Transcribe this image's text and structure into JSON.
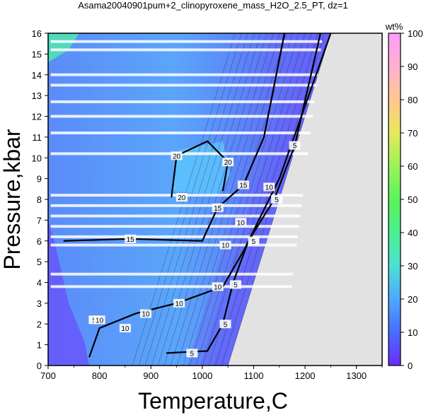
{
  "chart_data": {
    "type": "heatmap",
    "title": "Asama20040901pum+2_clinopyroxene_mass_H2O_2.5_PT, dz=1",
    "xlabel": "Temperature,C",
    "ylabel": "Pressure,kbar",
    "xlim": [
      700,
      1350
    ],
    "ylim": [
      0,
      16
    ],
    "xticks": [
      700,
      800,
      900,
      1000,
      1100,
      1200,
      1300
    ],
    "yticks": [
      0,
      1,
      2,
      3,
      4,
      5,
      6,
      7,
      8,
      9,
      10,
      11,
      12,
      13,
      14,
      15,
      16
    ],
    "colorbar": {
      "label": "wt%",
      "range": [
        0,
        100
      ],
      "ticks": [
        0,
        10,
        20,
        30,
        40,
        50,
        60,
        70,
        80,
        90,
        100
      ]
    },
    "contour_interval": 1,
    "labeled_contours": [
      5,
      10,
      15,
      20
    ],
    "contour_labels": [
      {
        "text": "20",
        "x": 950,
        "y": 10.1
      },
      {
        "text": "20",
        "x": 1050,
        "y": 9.8
      },
      {
        "text": "20",
        "x": 960,
        "y": 8.1
      },
      {
        "text": "15",
        "x": 1080,
        "y": 8.7
      },
      {
        "text": "15",
        "x": 1030,
        "y": 7.6
      },
      {
        "text": "15",
        "x": 860,
        "y": 6.1
      },
      {
        "text": "10",
        "x": 1130,
        "y": 8.6
      },
      {
        "text": "10",
        "x": 1075,
        "y": 6.9
      },
      {
        "text": "10",
        "x": 1045,
        "y": 5.8
      },
      {
        "text": "10",
        "x": 1030,
        "y": 3.8
      },
      {
        "text": "10",
        "x": 890,
        "y": 2.5
      },
      {
        "text": "10",
        "x": 955,
        "y": 3.0
      },
      {
        "text": "10",
        "x": 850,
        "y": 1.8
      },
      {
        "text": "5",
        "x": 1180,
        "y": 10.6
      },
      {
        "text": "5",
        "x": 1145,
        "y": 8.0
      },
      {
        "text": "5",
        "x": 1100,
        "y": 6.0
      },
      {
        "text": "5",
        "x": 1065,
        "y": 3.9
      },
      {
        "text": "5",
        "x": 1045,
        "y": 2.0
      },
      {
        "text": "5",
        "x": 980,
        "y": 0.6
      },
      {
        "text": "5",
        "x": 790,
        "y": 2.2
      },
      {
        "text": "10",
        "x": 800,
        "y": 2.2
      }
    ],
    "regions": {
      "no_data_fill": "#e2e2e2",
      "data_boundary_right": [
        [
          1050,
          0
        ],
        [
          1250,
          16
        ]
      ]
    },
    "colors": {
      "low": "#6633ff",
      "mid": "#55aaff",
      "high": "#44ee99",
      "top": "#ff99ff"
    }
  }
}
